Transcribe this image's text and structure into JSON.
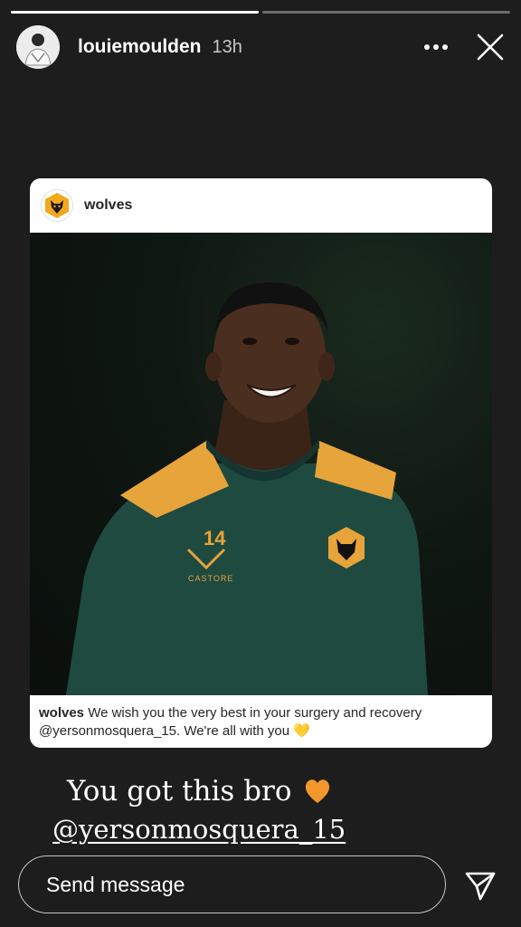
{
  "progress": {
    "segments": [
      {
        "fill": 1.0
      },
      {
        "fill": 0.0
      }
    ]
  },
  "header": {
    "username": "louiemoulden",
    "time": "13h"
  },
  "post": {
    "account": "wolves",
    "caption_user": "wolves",
    "caption_text": " We wish you the very best in your surgery and recovery @yersonmosquera_15. We're all with you 💛",
    "shirt_number": "14",
    "shirt_brand": "CASTORE"
  },
  "story": {
    "line1": "You got this bro",
    "line2": "@yersonmosquera_15"
  },
  "send_bar": {
    "placeholder": "Send message"
  },
  "colors": {
    "wolves_gold": "#f4a81d",
    "shirt_green": "#1f4a40",
    "heart_orange": "#f3962b"
  }
}
